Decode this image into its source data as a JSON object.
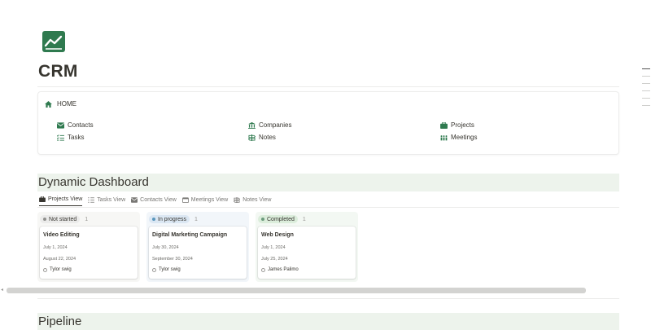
{
  "page": {
    "title": "CRM",
    "icon": "chart-line-icon"
  },
  "home": {
    "label": "HOME",
    "items": [
      {
        "label": "Contacts",
        "icon": "envelope-icon"
      },
      {
        "label": "Companies",
        "icon": "building-icon"
      },
      {
        "label": "Projects",
        "icon": "briefcase-icon"
      },
      {
        "label": "Tasks",
        "icon": "checklist-icon"
      },
      {
        "label": "Notes",
        "icon": "signpost-icon"
      },
      {
        "label": "Meetings",
        "icon": "people-icon"
      }
    ]
  },
  "dashboard": {
    "heading": "Dynamic Dashboard",
    "views": [
      {
        "label": "Projects View",
        "icon": "briefcase-icon",
        "active": true
      },
      {
        "label": "Tasks View",
        "icon": "checklist-icon",
        "active": false
      },
      {
        "label": "Contacts View",
        "icon": "envelope-icon",
        "active": false
      },
      {
        "label": "Meetings View",
        "icon": "calendar-icon",
        "active": false
      },
      {
        "label": "Notes View",
        "icon": "signpost-icon",
        "active": false
      }
    ],
    "columns": [
      {
        "status": "Not started",
        "count": "1",
        "dot_color": "#91918e",
        "pill_bg": "#ebebea",
        "col_bg": "#f7f7f5",
        "card": {
          "name": "Video Editing",
          "date1": "July 1, 2024",
          "date2": "August 22, 2024",
          "owner": "Tylor swig"
        }
      },
      {
        "status": "In progress",
        "count": "1",
        "dot_color": "#5b97bd",
        "pill_bg": "#dbe7f3",
        "col_bg": "#f2f6fa",
        "card": {
          "name": "Digital Marketing Campaign",
          "date1": "July 30, 2024",
          "date2": "September 30, 2024",
          "owner": "Tylor swig"
        }
      },
      {
        "status": "Completed",
        "count": "1",
        "dot_color": "#6c9b7d",
        "pill_bg": "#dbeddb",
        "col_bg": "#f3f8f3",
        "card": {
          "name": "Web Design",
          "date1": "July 1, 2024",
          "date2": "July 25, 2024",
          "owner": "James Palimo"
        }
      }
    ]
  },
  "pipeline": {
    "heading": "Pipeline"
  },
  "colors": {
    "accent_green": "#2f7a4f",
    "section_bg": "#edf3ec"
  }
}
